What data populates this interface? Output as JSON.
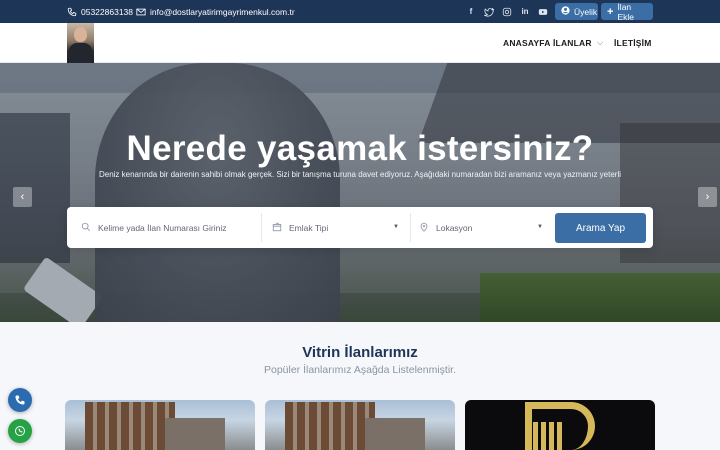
{
  "topbar": {
    "phone": "05322863138",
    "email": "info@dostlaryatirimgayrimenkul.com.tr",
    "socials": [
      "facebook-icon",
      "twitter-icon",
      "instagram-icon",
      "linkedin-icon",
      "youtube-icon"
    ],
    "membership_label": "Üyelik",
    "add_listing_label": "İlan Ekle"
  },
  "nav": {
    "home": "ANASAYFA",
    "listings": "İLANLAR",
    "contact": "İLETİŞİM"
  },
  "hero": {
    "title": "Nerede yaşamak istersiniz?",
    "subtitle": "Deniz kenarında bir dairenin sahibi olmak gerçek. Sizi bir tanışma turuna davet ediyoruz. Aşağıdaki numaradan bizi aramanız veya yazmanız yeterli"
  },
  "search": {
    "keyword_placeholder": "Kelime yada İlan Numarası Giriniz",
    "type_label": "Emlak Tipi",
    "location_label": "Lokasyon",
    "button": "Arama Yap"
  },
  "featured": {
    "title": "Vitrin İlanlarımız",
    "subtitle": "Popüler İlanlarımız Aşağda Listelenmiştir."
  },
  "colors": {
    "topbar": "#1d3557",
    "accent": "#3a6ea5",
    "whatsapp": "#25a244"
  }
}
